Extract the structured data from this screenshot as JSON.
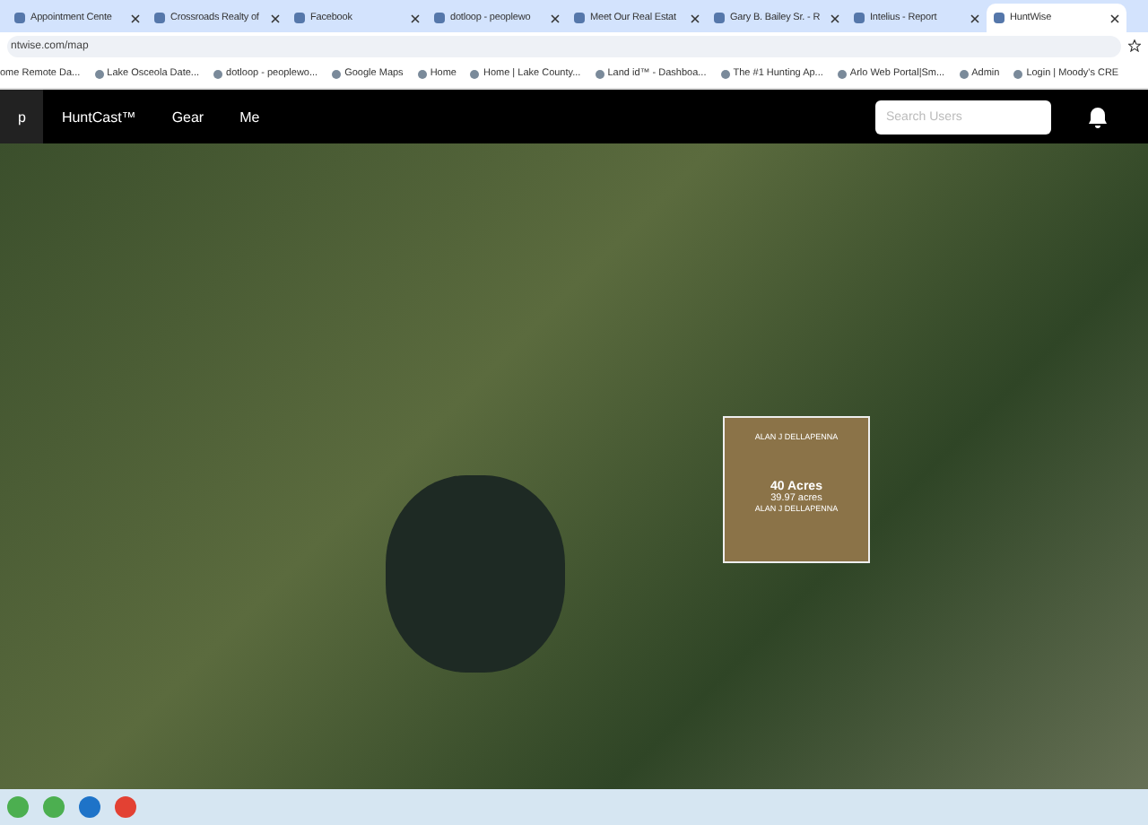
{
  "tabs": [
    {
      "title": "Appointment Cente",
      "selected": false
    },
    {
      "title": "Crossroads Realty of",
      "selected": false
    },
    {
      "title": "Facebook",
      "selected": false
    },
    {
      "title": "dotloop - peoplewo",
      "selected": false
    },
    {
      "title": "Meet Our Real Estat",
      "selected": false
    },
    {
      "title": "Gary B. Bailey Sr. - R",
      "selected": false
    },
    {
      "title": "Intelius - Report",
      "selected": false
    },
    {
      "title": "HuntWise",
      "selected": true
    }
  ],
  "address": "ntwise.com/map",
  "bookmarks": [
    "ome Remote Da...",
    "Lake Osceola Date...",
    "dotloop - peoplewo...",
    "Google Maps",
    "Home",
    "Home | Lake County...",
    "Land id™ - Dashboa...",
    "The #1 Hunting Ap...",
    "Arlo Web Portal|Sm...",
    "Admin",
    "Login | Moody's CRE"
  ],
  "nav": {
    "items": [
      {
        "label": "p",
        "selected": true
      },
      {
        "label": "HuntCast™",
        "selected": false
      },
      {
        "label": "Gear",
        "selected": false
      },
      {
        "label": "Me",
        "selected": false
      }
    ],
    "search": {
      "placeholder": "Search Users"
    }
  },
  "map": {
    "parcel": {
      "owner_top": "ALAN J DELLAPENNA",
      "acres": "40 Acres",
      "exact": "39.97 acres",
      "owner": "ALAN J DELLAPENNA"
    }
  }
}
